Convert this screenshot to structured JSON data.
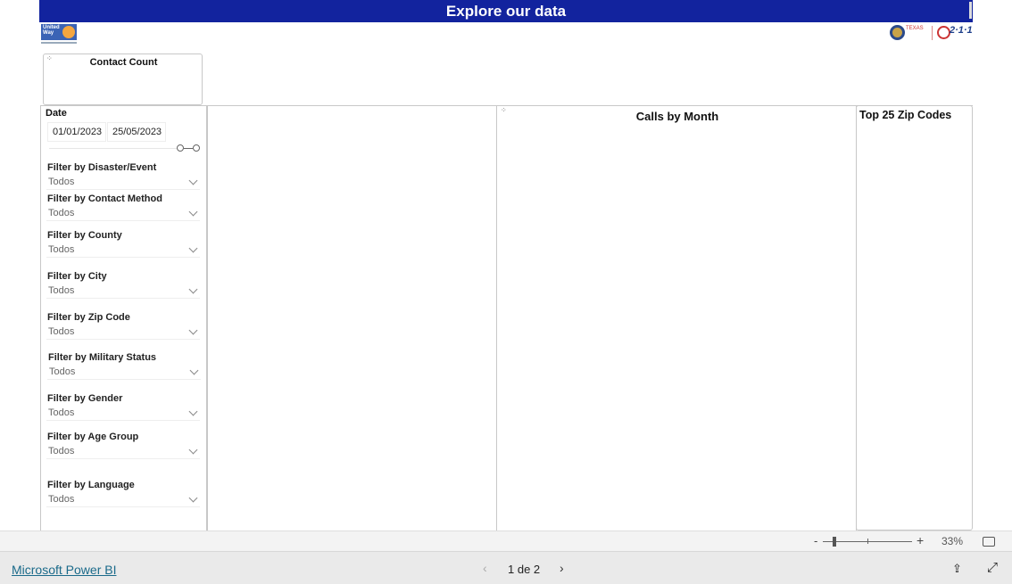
{
  "header": {
    "title": "Explore our data"
  },
  "logos": {
    "left": "United Way",
    "right_1": "TEXAS Health and Human Services",
    "right_2": "2-1-1 TEXAS"
  },
  "cards": {
    "contact_count": "Contact Count",
    "calls_by_month": "Calls by Month",
    "top_zip": "Top 25 Zip Codes"
  },
  "date_slicer": {
    "label": "Date",
    "start": "01/01/2023",
    "end": "25/05/2023"
  },
  "filters": [
    {
      "label": "Filter by Disaster/Event",
      "value": "Todos"
    },
    {
      "label": "Filter by Contact Method",
      "value": "Todos"
    },
    {
      "label": "Filter by County",
      "value": "Todos"
    },
    {
      "label": "Filter by City",
      "value": "Todos"
    },
    {
      "label": "Filter by Zip Code",
      "value": "Todos"
    },
    {
      "label": "Filter by Military Status",
      "value": "Todos"
    },
    {
      "label": "Filter by Gender",
      "value": "Todos"
    },
    {
      "label": "Filter by Age Group",
      "value": "Todos"
    },
    {
      "label": "Filter by Language",
      "value": "Todos"
    }
  ],
  "zoom": {
    "minus": "-",
    "plus": "+",
    "level": "33%"
  },
  "footer": {
    "link": "Microsoft Power BI",
    "page": "1 de 2"
  },
  "colors": {
    "banner": "#12239e"
  }
}
